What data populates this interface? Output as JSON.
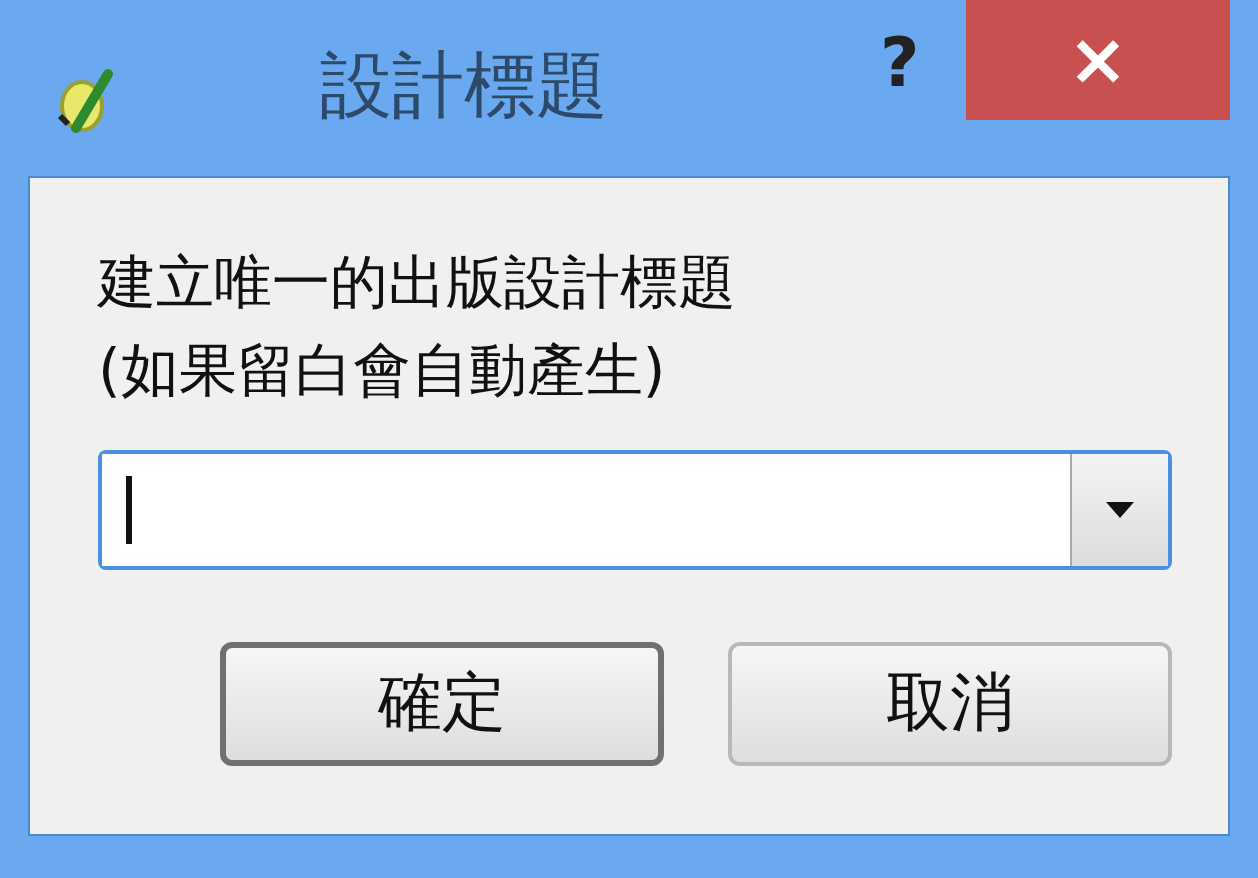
{
  "window": {
    "title": "設計標題",
    "help": "?",
    "close": "×"
  },
  "prompt": {
    "lines": [
      "建立唯一的出版設計標題",
      "(如果留白會自動產生)"
    ]
  },
  "combo": {
    "focused": true
  },
  "buttons": [
    {
      "label": "確定",
      "default": true
    },
    {
      "label": "取消",
      "default": false
    }
  ]
}
